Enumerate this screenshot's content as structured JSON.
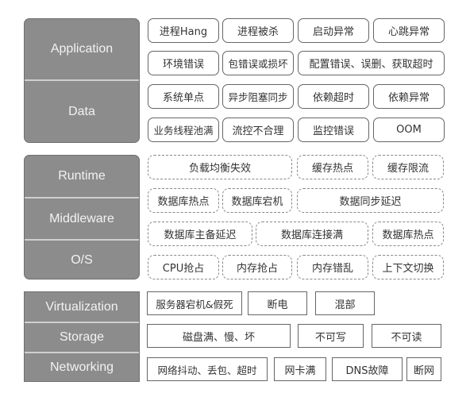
{
  "group1": {
    "layers": [
      "Application",
      "Data"
    ],
    "rows": [
      [
        "进程Hang",
        "进程被杀",
        "启动异常",
        "心跳异常"
      ],
      [
        "环境错误",
        "包错误或损坏",
        "配置错误、误删、获取超时"
      ],
      [
        "系统单点",
        "异步阻塞同步",
        "依赖超时",
        "依赖异常"
      ],
      [
        "业务线程池满",
        "流控不合理",
        "监控错误",
        "OOM"
      ]
    ]
  },
  "group2": {
    "layers": [
      "Runtime",
      "Middleware",
      "O/S"
    ],
    "rows": [
      [
        "负载均衡失效",
        "缓存热点",
        "缓存限流"
      ],
      [
        "数据库热点",
        "数据库宕机",
        "数据同步延迟"
      ],
      [
        "数据库主备延迟",
        "数据库连接满",
        "数据库热点"
      ],
      [
        "CPU抢占",
        "内存抢占",
        "内存错乱",
        "上下文切换"
      ]
    ]
  },
  "group3": {
    "layers": [
      "Virtualization",
      "Storage",
      "Networking"
    ],
    "rows": [
      [
        "服务器宕机&假死",
        "断电",
        "混部"
      ],
      [
        "磁盘满、慢、坏",
        "不可写",
        "不可读"
      ],
      [
        "网络抖动、丢包、超时",
        "网卡满",
        "DNS故障",
        "断网"
      ]
    ]
  }
}
